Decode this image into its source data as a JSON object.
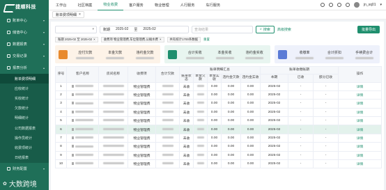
{
  "brand": {
    "name": "捷顺科技"
  },
  "sidebar": {
    "items": [
      {
        "label": "账单中心",
        "icon": "bill-icon"
      },
      {
        "label": "储值中心",
        "icon": "wallet-icon"
      },
      {
        "label": "数据报表",
        "icon": "report-icon"
      },
      {
        "label": "交易记录",
        "icon": "record-icon"
      },
      {
        "label": "报表分析",
        "icon": "analysis-icon"
      }
    ],
    "sub": [
      "账单费项明细",
      "应收统计",
      "实收统计",
      "欠款统计",
      "明细统计",
      "公司数据报表",
      "操作员统计",
      "收费项统计",
      "日结报表"
    ],
    "bottom": "财务配置",
    "watermark": "大数跨境"
  },
  "topnav": {
    "items": [
      "工作台",
      "社区档案",
      "物业收费",
      "客户服务",
      "物业管理",
      "人行服务",
      "车行服务"
    ],
    "user": "jn_sq01"
  },
  "tab": {
    "label": "账单费项明细"
  },
  "filter": {
    "select_placeholder": "",
    "period_label": "账期",
    "start": "2025-02",
    "to": "至",
    "end": "2025-02",
    "query_placeholder": "查询结果",
    "search": "搜索",
    "advanced": "高级搜索",
    "export": "批量导出"
  },
  "chips": [
    "账期 2025-02 至 2025-02",
    "收费项 物业管理费,车位管理费,公摊水费",
    "共有统计1700条数据"
  ],
  "chips_reset": "重置",
  "cards": [
    {
      "color": "#e88a2e",
      "bg": "#fdf3e8",
      "labels": [
        "应付欠款",
        "本金欠款",
        "违约金欠款"
      ]
    },
    {
      "color": "#1f8f6e",
      "bg": "#e8f5f0",
      "labels": [
        "合计实收",
        "本金实收",
        "违约金实收"
      ]
    },
    {
      "color": "#5b7bd6",
      "bg": "#eef1fb",
      "labels": [
        "收缴率",
        "合计折扣",
        "手续费合计"
      ]
    }
  ],
  "table": {
    "headers": {
      "idx": "序号",
      "cust": "客户名称",
      "house": "房间名称",
      "item": "收费项",
      "total": "合计欠款",
      "status": "账单状态",
      "group1": "账单明细汇总",
      "group2": "账单收缴账期",
      "principal": "本金欠款",
      "prin_paid": "本金实收",
      "penalty": "违约金欠款",
      "pen_paid": "违约金实收",
      "period": "本期",
      "paid": "已收",
      "partial": "部分已收",
      "op": "操作"
    },
    "rows": [
      {
        "idx": "1",
        "item": "物业管理费",
        "status": "未收",
        "p": "0.00",
        "pp": "0.00",
        "pe": "0.00",
        "pep": "0.00",
        "period": "2025-02",
        "paid": "-",
        "part": "-",
        "op": "详情"
      },
      {
        "idx": "2",
        "item": "物业管理费",
        "status": "未收",
        "p": "0.00",
        "pp": "0.00",
        "pe": "0.00",
        "pep": "0.00",
        "period": "2025-02",
        "paid": "-",
        "part": "-",
        "op": "详情"
      },
      {
        "idx": "3",
        "item": "物业管理费",
        "status": "未收",
        "p": "0.00",
        "pp": "0.00",
        "pe": "0.00",
        "pep": "0.00",
        "period": "2025-02",
        "paid": "-",
        "part": "-",
        "op": "详情"
      },
      {
        "idx": "4",
        "item": "物业管理费",
        "status": "未收",
        "p": "0.00",
        "pp": "0.00",
        "pe": "0.00",
        "pep": "0.00",
        "period": "2025-02",
        "paid": "-",
        "part": "-",
        "op": "详情"
      },
      {
        "idx": "5",
        "item": "物业管理费",
        "status": "未收",
        "p": "0.00",
        "pp": "0.00",
        "pe": "0.00",
        "pep": "0.00",
        "period": "2025-02",
        "paid": "-",
        "part": "-",
        "op": "详情"
      },
      {
        "idx": "6",
        "item": "物业管理费",
        "status": "未收",
        "p": "0.00",
        "pp": "0.00",
        "pe": "0.00",
        "pep": "0.00",
        "period": "2025-02",
        "paid": "-",
        "part": "-",
        "op": "详情"
      },
      {
        "idx": "7",
        "item": "物业管理费",
        "status": "未收",
        "p": "0.00",
        "pp": "0.00",
        "pe": "0.00",
        "pep": "0.00",
        "period": "2025-02",
        "paid": "-",
        "part": "-",
        "op": "详情"
      },
      {
        "idx": "8",
        "item": "物业管理费",
        "status": "未收",
        "p": "0.00",
        "pp": "0.00",
        "pe": "0.00",
        "pep": "0.00",
        "period": "2025-02",
        "paid": "-",
        "part": "-",
        "op": "详情"
      },
      {
        "idx": "9",
        "item": "物业管理费",
        "status": "未收",
        "p": "0.00",
        "pp": "0.00",
        "pe": "0.00",
        "pep": "0.00",
        "period": "2025-02",
        "paid": "-",
        "part": "-",
        "op": "详情"
      },
      {
        "idx": "10",
        "item": "物业管理费",
        "status": "未收",
        "p": "0.00",
        "pp": "0.00",
        "pe": "0.00",
        "pep": "0.00",
        "period": "2025-02",
        "paid": "-",
        "part": "-",
        "op": "详情"
      }
    ],
    "highlight_row": 6
  }
}
